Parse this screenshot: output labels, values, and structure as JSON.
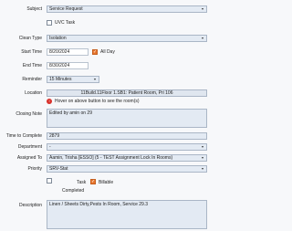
{
  "subject": {
    "label": "Subject",
    "value": "Service Request"
  },
  "uvc_task": {
    "label": "UVC Task"
  },
  "clean_type": {
    "label": "Clean Type",
    "value": "Isolation"
  },
  "start_time": {
    "label": "Start Time",
    "value": "8/20/2024"
  },
  "all_day": {
    "label": "All Day"
  },
  "end_time": {
    "label": "End Time",
    "value": "8/30/2024"
  },
  "reminder": {
    "label": "Reminder",
    "value": "15 Minutes"
  },
  "location": {
    "label": "Location",
    "value": "11Build.11Floor 1.SB1: Patient Room, Pri 106",
    "hint": "Hover on above button to see the room(s)"
  },
  "closing_note": {
    "label": "Closing Note",
    "value": "Edited by amin on 29"
  },
  "time_to_complete": {
    "label": "Time to Complete",
    "value": "2879"
  },
  "department": {
    "label": "Department",
    "value": "-"
  },
  "assigned_to": {
    "label": "Assigned To",
    "value": "Aamin, Trisha [ESSO] (5 - TEST Assignment Lock In Rooms)"
  },
  "priority": {
    "label": "Priority",
    "value": "SRV-Stat"
  },
  "task": {
    "label": "Task"
  },
  "billable": {
    "label": "Billable"
  },
  "completed": {
    "label": "Completed"
  },
  "description": {
    "label": "Description",
    "value": "Linen / Sheets Dirty,Pests In Room, Service 29.3"
  },
  "icons": {
    "dropdown": "▾",
    "check": "✓",
    "alert": "!"
  }
}
